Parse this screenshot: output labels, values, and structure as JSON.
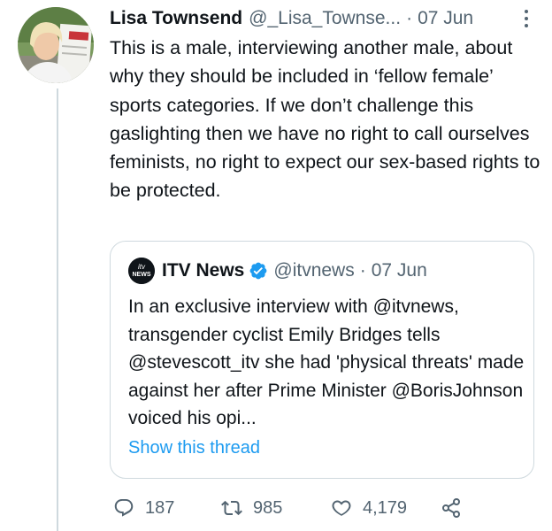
{
  "tweet": {
    "author": {
      "name": "Lisa Townsend",
      "handle": "@_Lisa_Townse...",
      "avatar_icon": "profile-photo"
    },
    "separator": "·",
    "date": "07 Jun",
    "text": "This is a male, interviewing another male, about why they should be included in ‘fellow female’ sports categories. If we don’t challenge this gaslighting then we have no right to call ourselves feminists, no right to expect our sex-based rights to be protected.",
    "more_icon": "more-vertical-icon"
  },
  "quoted": {
    "author": {
      "name": "ITV News",
      "handle": "@itvnews",
      "avatar_logo_top": "itv",
      "avatar_logo_bottom": "NEWS",
      "verified": true
    },
    "separator": "·",
    "date": "07 Jun",
    "text": "In an exclusive interview with @itvnews, transgender cyclist Emily Bridges tells @stevescott_itv she had 'physical threats' made against her after Prime Minister @BorisJohnson voiced his opi...",
    "show_thread": "Show this thread"
  },
  "actions": {
    "replies": "187",
    "retweets": "985",
    "likes": "4,179",
    "icons": [
      "reply-icon",
      "retweet-icon",
      "like-icon",
      "share-icon"
    ]
  },
  "colors": {
    "link": "#1d9bf0",
    "secondary_text": "#536471",
    "primary_text": "#0f1419",
    "border": "#cfd9de"
  }
}
